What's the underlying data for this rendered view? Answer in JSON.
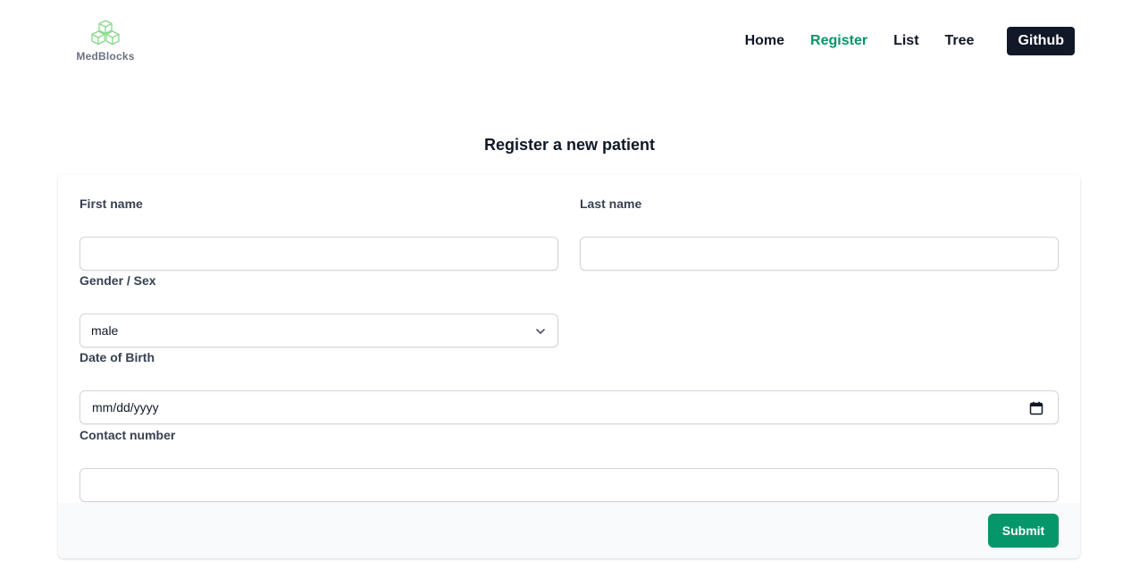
{
  "brand": {
    "name": "MedBlocks",
    "logo_icon": "cubes-logo-icon"
  },
  "nav": {
    "items": [
      {
        "label": "Home",
        "active": false
      },
      {
        "label": "Register",
        "active": true
      },
      {
        "label": "List",
        "active": false
      },
      {
        "label": "Tree",
        "active": false
      }
    ],
    "github_label": "Github"
  },
  "page": {
    "title": "Register a new patient"
  },
  "form": {
    "first_name": {
      "label": "First name",
      "value": ""
    },
    "last_name": {
      "label": "Last name",
      "value": ""
    },
    "gender": {
      "label": "Gender / Sex",
      "value": "male"
    },
    "dob": {
      "label": "Date of Birth",
      "value": "mm/dd/yyyy"
    },
    "contact": {
      "label": "Contact number",
      "value": ""
    },
    "submit_label": "Submit"
  },
  "colors": {
    "accent": "#059669",
    "dark": "#111827",
    "footer_bg": "#f9fafb"
  }
}
